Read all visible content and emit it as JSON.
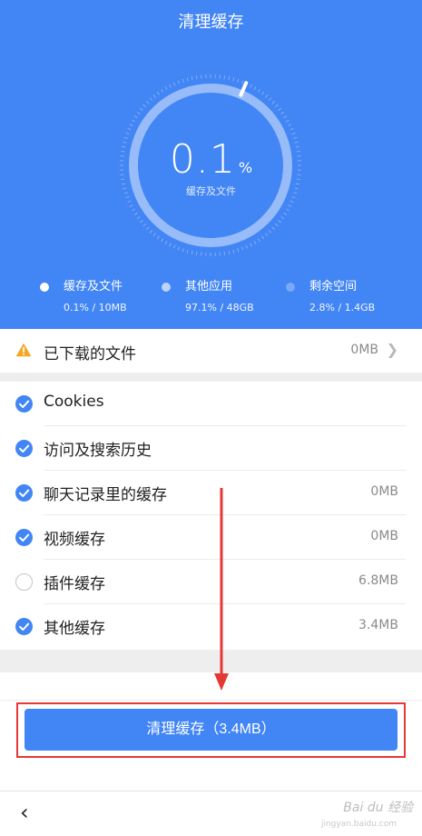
{
  "header": {
    "title": "清理缓存",
    "percent": "0.1",
    "percent_unit": "%",
    "ring_label": "缓存及文件",
    "usage_fraction": 0.001
  },
  "legend": [
    {
      "name": "缓存及文件",
      "value": "0.1% / 10MB",
      "color": "#ffffff"
    },
    {
      "name": "其他应用",
      "value": "97.1% / 48GB",
      "color": "#bcd4fb"
    },
    {
      "name": "剩余空间",
      "value": "2.8% / 1.4GB",
      "color": "#7aa9f7"
    }
  ],
  "downloads": {
    "label": "已下载的文件",
    "value": "0MB",
    "icon": "warning-icon",
    "icon_color": "#f5a623"
  },
  "items": [
    {
      "label": "Cookies",
      "value": "",
      "checked": true
    },
    {
      "label": "访问及搜索历史",
      "value": "",
      "checked": true
    },
    {
      "label": "聊天记录里的缓存",
      "value": "0MB",
      "checked": true
    },
    {
      "label": "视频缓存",
      "value": "0MB",
      "checked": true
    },
    {
      "label": "插件缓存",
      "value": "6.8MB",
      "checked": false
    },
    {
      "label": "其他缓存",
      "value": "3.4MB",
      "checked": true
    }
  ],
  "action": {
    "label": "清理缓存（3.4MB）"
  },
  "nav": {
    "back": "‹"
  },
  "watermark": {
    "brand": "Bai du 经验",
    "url": "jingyan.baidu.com"
  },
  "colors": {
    "primary": "#4285f4",
    "annotation": "#e53935",
    "warning": "#f5a623"
  }
}
